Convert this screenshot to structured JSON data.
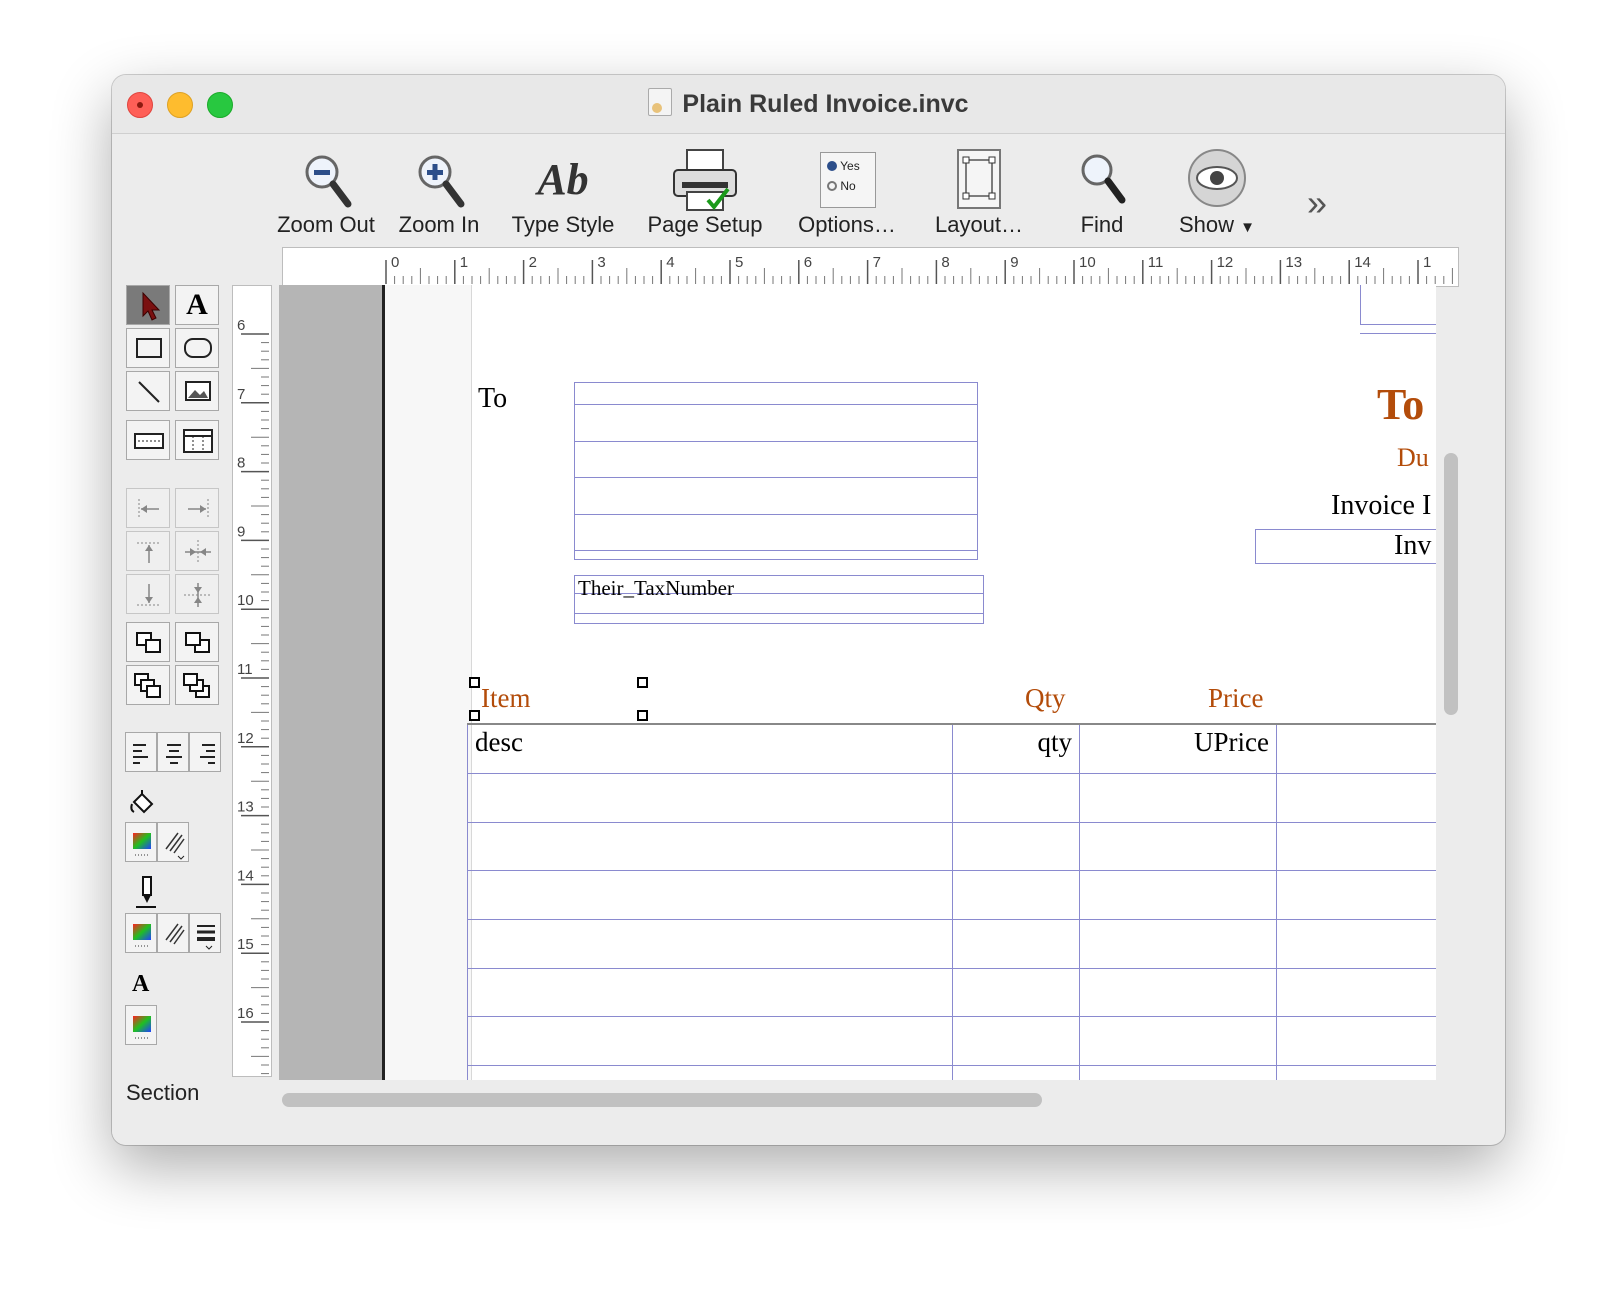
{
  "window": {
    "title": "Plain Ruled Invoice.invc"
  },
  "toolbar": {
    "items": [
      {
        "label": "Zoom Out",
        "icon": "zoom-out-icon"
      },
      {
        "label": "Zoom In",
        "icon": "zoom-in-icon"
      },
      {
        "label": "Type Style",
        "icon": "type-style-icon"
      },
      {
        "label": "Page Setup",
        "icon": "printer-icon"
      },
      {
        "label": "Options…",
        "icon": "options-radio-icon"
      },
      {
        "label": "Layout…",
        "icon": "layout-icon"
      },
      {
        "label": "Find",
        "icon": "magnifier-icon"
      },
      {
        "label": "Show",
        "icon": "eye-icon"
      }
    ],
    "type_style_glyph": "Ab",
    "options_yes": "Yes",
    "options_no": "No",
    "overflow": "»"
  },
  "ruler": {
    "h_ticks": [
      "0",
      "1",
      "2",
      "3",
      "4",
      "5",
      "6",
      "7",
      "8",
      "9",
      "10",
      "11",
      "12",
      "13",
      "14",
      "1"
    ],
    "v_ticks": [
      "6",
      "7",
      "8",
      "9",
      "10",
      "11",
      "12",
      "13",
      "14",
      "15",
      "16"
    ]
  },
  "palette": {
    "text_tool_glyph": "A",
    "text_color_glyph": "A",
    "section_label": "Section"
  },
  "document": {
    "to_label": "To",
    "tax_field": "Their_TaxNumber",
    "total_partial": "To",
    "due_partial": "Du",
    "invoice_label_partial": "Invoice I",
    "invoice_field_partial": "Inv",
    "columns": {
      "item": "Item",
      "qty": "Qty",
      "price": "Price"
    },
    "row": {
      "desc": "desc",
      "qty": "qty",
      "uprice": "UPrice"
    }
  },
  "colors": {
    "accent_orange": "#b34c0a",
    "rule_blue": "#8a8acf"
  }
}
